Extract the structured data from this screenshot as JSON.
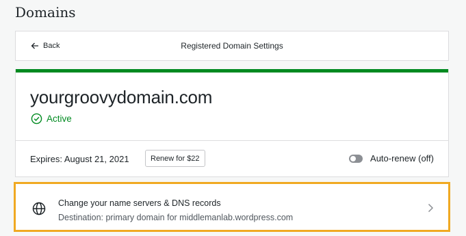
{
  "page": {
    "title": "Domains"
  },
  "header": {
    "back_label": "Back",
    "title": "Registered Domain Settings"
  },
  "domain": {
    "name": "yourgroovydomain.com",
    "status": "Active",
    "expires": "Expires: August 21, 2021",
    "renew_label": "Renew for $22",
    "autorenew_label": "Auto-renew (off)",
    "autorenew_on": false
  },
  "dns": {
    "title": "Change your name servers & DNS records",
    "subtitle": "Destination: primary domain for middlemanlab.wordpress.com"
  },
  "colors": {
    "active_green": "#008a20",
    "highlight_orange": "#f0a922"
  },
  "icons": {
    "back": "arrow-left-icon",
    "status": "check-circle-icon",
    "dns": "globe-icon",
    "chevron": "chevron-right-icon"
  }
}
